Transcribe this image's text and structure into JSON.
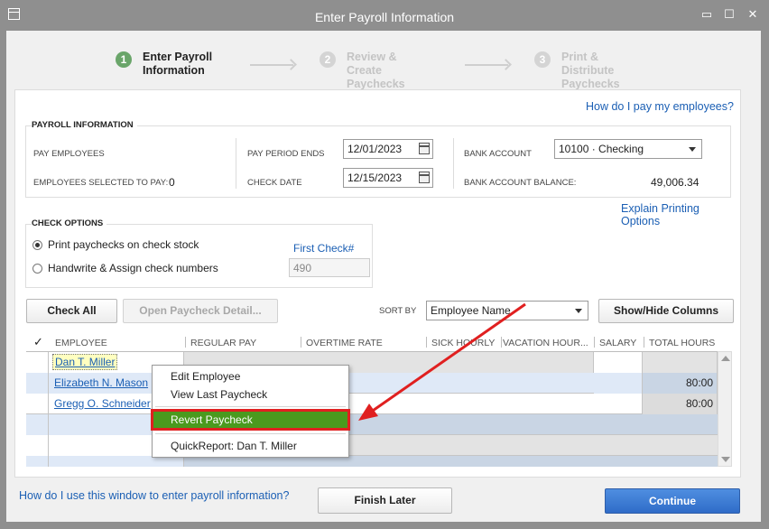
{
  "window": {
    "title": "Enter Payroll Information"
  },
  "steps": [
    {
      "num": "1",
      "label": "Enter Payroll Information"
    },
    {
      "num": "2",
      "label": "Review & Create Paychecks"
    },
    {
      "num": "3",
      "label": "Print & Distribute Paychecks"
    }
  ],
  "help_link": "How do I pay my employees?",
  "payroll_info": {
    "title": "PAYROLL INFORMATION",
    "pay_employees_label": "PAY EMPLOYEES",
    "employees_selected_label": "EMPLOYEES SELECTED TO PAY:",
    "employees_selected_value": "0",
    "pay_period_ends_label": "PAY PERIOD ENDS",
    "pay_period_ends_value": "12/01/2023",
    "check_date_label": "CHECK DATE",
    "check_date_value": "12/15/2023",
    "bank_account_label": "BANK ACCOUNT",
    "bank_account_value": "10100 · Checking",
    "bank_balance_label": "BANK ACCOUNT BALANCE:",
    "bank_balance_value": "49,006.34"
  },
  "explain_printing": "Explain Printing Options",
  "check_options": {
    "title": "CHECK OPTIONS",
    "option_print": "Print paychecks on check stock",
    "option_handwrite": "Handwrite & Assign check numbers",
    "first_check_label": "First Check#",
    "first_check_value": "490"
  },
  "toolbar": {
    "check_all": "Check All",
    "open_detail": "Open Paycheck Detail...",
    "sort_by_label": "SORT BY",
    "sort_by_value": "Employee Name",
    "show_hide": "Show/Hide Columns"
  },
  "grid": {
    "check_header": "✓",
    "columns": [
      "EMPLOYEE",
      "REGULAR PAY",
      "OVERTIME RATE",
      "SICK HOURLY",
      "VACATION HOUR...",
      "SALARY",
      "TOTAL HOURS"
    ],
    "rows": [
      {
        "employee": "Dan T. Miller",
        "total_hours": ""
      },
      {
        "employee": "Elizabeth N. Mason",
        "total_hours": "80:00"
      },
      {
        "employee": "Gregg O. Schneider",
        "total_hours": "80:00"
      }
    ]
  },
  "context_menu": {
    "items": [
      "Edit Employee",
      "View Last Paycheck",
      "Revert Paycheck",
      "QuickReport: Dan T. Miller"
    ],
    "highlighted": "Revert Paycheck"
  },
  "footer": {
    "help_link": "How do I use this window to enter payroll information?",
    "finish_later": "Finish Later",
    "continue": "Continue"
  },
  "colors": {
    "accent": "#2f6cc8",
    "highlight": "#4a9a1e",
    "annotation": "#e02020",
    "link": "#1b5fb4"
  }
}
